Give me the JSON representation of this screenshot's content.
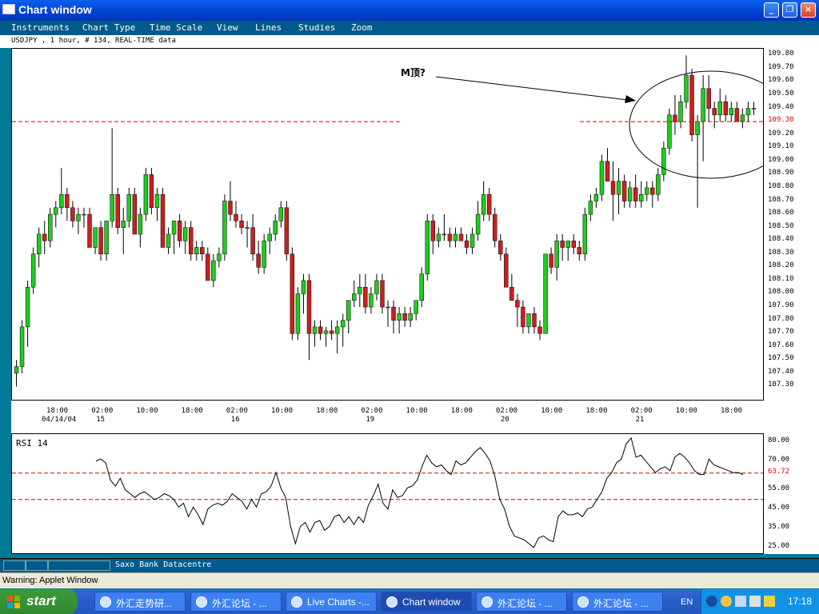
{
  "window": {
    "title": "Chart window",
    "min_label": "_",
    "max_label": "❐",
    "close_label": "×"
  },
  "menu": [
    "Instruments",
    "Chart Type",
    "Time Scale",
    "View",
    "Lines",
    "Studies",
    "Zoom"
  ],
  "info": "USDJPY , 1 hour, # 134, REAL-TIME data",
  "annotation": "M顶?",
  "price_levels": {
    "resistance": 109.3,
    "resistance_label": "109.30"
  },
  "chart_data": [
    {
      "type": "candlestick",
      "ylim": [
        107.2,
        109.85
      ],
      "yticks": [
        "109.80",
        "109.70",
        "109.60",
        "109.50",
        "109.40",
        "109.30",
        "109.20",
        "109.10",
        "109.00",
        "108.90",
        "108.80",
        "108.70",
        "108.60",
        "108.50",
        "108.40",
        "108.30",
        "108.20",
        "108.10",
        "108.00",
        "107.90",
        "107.80",
        "107.70",
        "107.60",
        "107.50",
        "107.40",
        "107.30"
      ],
      "xticks": [
        {
          "time": "18:00",
          "date": "04/14/04"
        },
        {
          "time": "02:00",
          "date": "15"
        },
        {
          "time": "10:00",
          "date": ""
        },
        {
          "time": "18:00",
          "date": ""
        },
        {
          "time": "02:00",
          "date": "16"
        },
        {
          "time": "10:00",
          "date": ""
        },
        {
          "time": "18:00",
          "date": ""
        },
        {
          "time": "02:00",
          "date": "19"
        },
        {
          "time": "10:00",
          "date": ""
        },
        {
          "time": "18:00",
          "date": ""
        },
        {
          "time": "02:00",
          "date": "20"
        },
        {
          "time": "10:00",
          "date": ""
        },
        {
          "time": "18:00",
          "date": ""
        },
        {
          "time": "02:00",
          "date": "21"
        },
        {
          "time": "10:00",
          "date": ""
        },
        {
          "time": "18:00",
          "date": ""
        }
      ],
      "candles": [
        [
          107.4,
          107.5,
          107.3,
          107.45
        ],
        [
          107.45,
          107.8,
          107.4,
          107.75
        ],
        [
          107.75,
          108.1,
          107.6,
          108.05
        ],
        [
          108.05,
          108.35,
          108.0,
          108.3
        ],
        [
          108.3,
          108.5,
          108.2,
          108.45
        ],
        [
          108.45,
          108.55,
          108.3,
          108.4
        ],
        [
          108.4,
          108.65,
          108.35,
          108.6
        ],
        [
          108.6,
          108.7,
          108.5,
          108.65
        ],
        [
          108.65,
          108.95,
          108.6,
          108.75
        ],
        [
          108.75,
          108.8,
          108.55,
          108.65
        ],
        [
          108.65,
          108.7,
          108.5,
          108.55
        ],
        [
          108.55,
          108.65,
          108.45,
          108.6
        ],
        [
          108.6,
          108.65,
          108.5,
          108.6
        ],
        [
          108.6,
          108.65,
          108.4,
          108.35
        ],
        [
          108.35,
          108.5,
          108.3,
          108.5
        ],
        [
          108.5,
          108.55,
          108.25,
          108.3
        ],
        [
          108.3,
          108.55,
          108.25,
          108.55
        ],
        [
          108.55,
          109.25,
          108.5,
          108.75
        ],
        [
          108.75,
          108.8,
          108.45,
          108.5
        ],
        [
          108.5,
          108.65,
          108.3,
          108.55
        ],
        [
          108.55,
          108.8,
          108.5,
          108.75
        ],
        [
          108.75,
          108.8,
          108.45,
          108.45
        ],
        [
          108.45,
          108.65,
          108.35,
          108.6
        ],
        [
          108.6,
          108.95,
          108.55,
          108.9
        ],
        [
          108.9,
          108.95,
          108.6,
          108.65
        ],
        [
          108.65,
          108.8,
          108.55,
          108.75
        ],
        [
          108.75,
          108.8,
          108.45,
          108.35
        ],
        [
          108.35,
          108.5,
          108.3,
          108.45
        ],
        [
          108.45,
          108.55,
          108.3,
          108.55
        ],
        [
          108.55,
          108.6,
          108.35,
          108.4
        ],
        [
          108.4,
          108.55,
          108.3,
          108.5
        ],
        [
          108.5,
          108.55,
          108.25,
          108.3
        ],
        [
          108.3,
          108.4,
          108.25,
          108.35
        ],
        [
          108.35,
          108.4,
          108.25,
          108.3
        ],
        [
          108.3,
          108.35,
          108.1,
          108.1
        ],
        [
          108.1,
          108.3,
          108.05,
          108.25
        ],
        [
          108.25,
          108.35,
          108.2,
          108.3
        ],
        [
          108.3,
          108.75,
          108.25,
          108.7
        ],
        [
          108.7,
          108.85,
          108.55,
          108.6
        ],
        [
          108.6,
          108.7,
          108.5,
          108.55
        ],
        [
          108.55,
          108.6,
          108.45,
          108.5
        ],
        [
          108.5,
          108.55,
          108.35,
          108.5
        ],
        [
          108.5,
          108.6,
          108.25,
          108.3
        ],
        [
          108.3,
          108.4,
          108.15,
          108.2
        ],
        [
          108.2,
          108.45,
          108.15,
          108.4
        ],
        [
          108.4,
          108.5,
          108.3,
          108.45
        ],
        [
          108.45,
          108.6,
          108.4,
          108.55
        ],
        [
          108.55,
          108.7,
          108.5,
          108.65
        ],
        [
          108.65,
          108.7,
          108.25,
          108.3
        ],
        [
          108.3,
          108.35,
          107.65,
          107.7
        ],
        [
          107.7,
          108.05,
          107.65,
          108.0
        ],
        [
          108.0,
          108.15,
          107.85,
          108.1
        ],
        [
          108.1,
          108.15,
          107.5,
          107.7
        ],
        [
          107.7,
          107.8,
          107.6,
          107.75
        ],
        [
          107.75,
          107.8,
          107.65,
          107.7
        ],
        [
          107.7,
          107.75,
          107.6,
          107.72
        ],
        [
          107.72,
          107.8,
          107.65,
          107.7
        ],
        [
          107.7,
          107.8,
          107.55,
          107.75
        ],
        [
          107.75,
          107.85,
          107.6,
          107.8
        ],
        [
          107.8,
          107.95,
          107.7,
          107.95
        ],
        [
          107.95,
          108.1,
          107.9,
          108.0
        ],
        [
          108.0,
          108.15,
          107.9,
          108.05
        ],
        [
          108.05,
          108.15,
          107.85,
          107.9
        ],
        [
          107.9,
          108.05,
          107.85,
          108.0
        ],
        [
          108.0,
          108.15,
          107.95,
          108.1
        ],
        [
          108.1,
          108.15,
          107.85,
          107.9
        ],
        [
          107.9,
          107.95,
          107.75,
          107.9
        ],
        [
          107.9,
          107.95,
          107.7,
          107.8
        ],
        [
          107.8,
          107.9,
          107.7,
          107.85
        ],
        [
          107.85,
          107.9,
          107.75,
          107.8
        ],
        [
          107.8,
          107.9,
          107.75,
          107.85
        ],
        [
          107.85,
          107.95,
          107.8,
          107.95
        ],
        [
          107.95,
          108.2,
          107.9,
          108.15
        ],
        [
          108.15,
          108.6,
          108.1,
          108.55
        ],
        [
          108.55,
          108.6,
          108.3,
          108.4
        ],
        [
          108.4,
          108.5,
          108.35,
          108.45
        ],
        [
          108.45,
          108.6,
          108.4,
          108.45
        ],
        [
          108.45,
          108.5,
          108.35,
          108.4
        ],
        [
          108.4,
          108.5,
          108.35,
          108.45
        ],
        [
          108.45,
          108.5,
          108.4,
          108.4
        ],
        [
          108.4,
          108.45,
          108.3,
          108.35
        ],
        [
          108.35,
          108.5,
          108.3,
          108.45
        ],
        [
          108.45,
          108.7,
          108.4,
          108.6
        ],
        [
          108.6,
          108.85,
          108.55,
          108.75
        ],
        [
          108.75,
          108.8,
          108.55,
          108.6
        ],
        [
          108.6,
          108.65,
          108.35,
          108.4
        ],
        [
          108.4,
          108.45,
          108.25,
          108.3
        ],
        [
          108.3,
          108.35,
          108.05,
          108.05
        ],
        [
          108.05,
          108.15,
          107.95,
          107.95
        ],
        [
          107.95,
          108.0,
          107.75,
          107.9
        ],
        [
          107.9,
          107.95,
          107.7,
          107.75
        ],
        [
          107.75,
          107.85,
          107.7,
          107.85
        ],
        [
          107.85,
          107.9,
          107.7,
          107.75
        ],
        [
          107.75,
          107.8,
          107.65,
          107.7
        ],
        [
          107.7,
          108.3,
          107.7,
          108.3
        ],
        [
          108.3,
          108.35,
          108.15,
          108.2
        ],
        [
          108.2,
          108.45,
          108.1,
          108.4
        ],
        [
          108.4,
          108.45,
          108.25,
          108.35
        ],
        [
          108.35,
          108.4,
          108.25,
          108.4
        ],
        [
          108.4,
          108.45,
          108.3,
          108.35
        ],
        [
          108.35,
          108.4,
          108.25,
          108.3
        ],
        [
          108.3,
          108.65,
          108.25,
          108.6
        ],
        [
          108.6,
          108.75,
          108.55,
          108.7
        ],
        [
          108.7,
          108.8,
          108.65,
          108.75
        ],
        [
          108.75,
          109.05,
          108.7,
          109.0
        ],
        [
          109.0,
          109.1,
          108.85,
          108.85
        ],
        [
          108.85,
          109.0,
          108.55,
          108.75
        ],
        [
          108.75,
          108.95,
          108.6,
          108.85
        ],
        [
          108.85,
          108.9,
          108.65,
          108.7
        ],
        [
          108.7,
          108.85,
          108.65,
          108.8
        ],
        [
          108.8,
          108.9,
          108.65,
          108.7
        ],
        [
          108.7,
          108.85,
          108.65,
          108.75
        ],
        [
          108.75,
          108.85,
          108.7,
          108.8
        ],
        [
          108.8,
          108.85,
          108.65,
          108.75
        ],
        [
          108.75,
          108.95,
          108.7,
          108.9
        ],
        [
          108.9,
          109.15,
          108.85,
          109.1
        ],
        [
          109.1,
          109.4,
          109.05,
          109.35
        ],
        [
          109.35,
          109.5,
          109.2,
          109.3
        ],
        [
          109.3,
          109.5,
          109.25,
          109.45
        ],
        [
          109.45,
          109.8,
          109.4,
          109.65
        ],
        [
          109.65,
          109.7,
          109.15,
          109.2
        ],
        [
          109.2,
          109.35,
          108.65,
          109.3
        ],
        [
          109.3,
          109.65,
          109.0,
          109.55
        ],
        [
          109.55,
          109.65,
          109.3,
          109.4
        ],
        [
          109.4,
          109.45,
          109.25,
          109.35
        ],
        [
          109.35,
          109.55,
          109.3,
          109.45
        ],
        [
          109.45,
          109.5,
          109.3,
          109.35
        ],
        [
          109.35,
          109.45,
          109.3,
          109.4
        ],
        [
          109.4,
          109.45,
          109.3,
          109.3
        ],
        [
          109.3,
          109.4,
          109.25,
          109.35
        ],
        [
          109.35,
          109.45,
          109.3,
          109.4
        ],
        [
          109.4,
          109.45,
          109.35,
          109.4
        ]
      ]
    },
    {
      "type": "line",
      "title": "RSI 14",
      "ylim": [
        22,
        84
      ],
      "yticks": [
        "80.00",
        "70.00",
        "55.00",
        "45.00",
        "35.00",
        "25.00"
      ],
      "levels": [
        63.72,
        50.0
      ],
      "level_label": "63.72",
      "values": [
        70,
        71,
        69,
        60,
        57,
        61,
        55,
        53,
        51,
        53,
        54,
        52,
        50,
        51,
        53,
        52,
        50,
        46,
        48,
        41,
        46,
        42,
        37,
        45,
        47,
        48,
        47,
        49,
        53,
        51,
        49,
        45,
        50,
        46,
        53,
        54,
        57,
        64,
        56,
        51,
        36,
        27,
        36,
        38,
        33,
        38,
        39,
        34,
        36,
        41,
        42,
        38,
        41,
        37,
        41,
        38,
        47,
        52,
        58,
        48,
        45,
        55,
        51,
        52,
        56,
        57,
        60,
        67,
        73,
        69,
        67,
        68,
        65,
        63,
        70,
        68,
        69,
        72,
        75,
        77,
        74,
        70,
        62,
        50,
        45,
        36,
        31,
        30,
        29,
        27,
        25,
        30,
        31,
        29,
        28,
        41,
        44,
        42,
        42,
        43,
        41,
        45,
        46,
        50,
        54,
        61,
        64,
        69,
        71,
        79,
        82,
        72,
        73,
        70,
        67,
        64,
        66,
        67,
        65,
        72,
        74,
        72,
        69,
        65,
        63,
        63,
        71,
        68,
        67,
        66,
        65,
        64,
        64,
        63
      ]
    }
  ],
  "status": {
    "source": "Saxo Bank Datacentre"
  },
  "warning": "Warning: Applet Window",
  "taskbar": {
    "start_label": "start",
    "tasks": [
      {
        "label": "外汇走势研...",
        "active": false
      },
      {
        "label": "外汇论坛 - ...",
        "active": false
      },
      {
        "label": "Live Charts -...",
        "active": false
      },
      {
        "label": "Chart window",
        "active": true
      },
      {
        "label": "外汇论坛 - ...",
        "active": false
      },
      {
        "label": "外汇论坛 - ...",
        "active": false
      }
    ],
    "lang": "EN",
    "clock": "17:18"
  },
  "colors": {
    "up": "#1fcc1f",
    "down": "#cc1f1f",
    "level": "#dd0000",
    "accent": "#0041d0"
  }
}
